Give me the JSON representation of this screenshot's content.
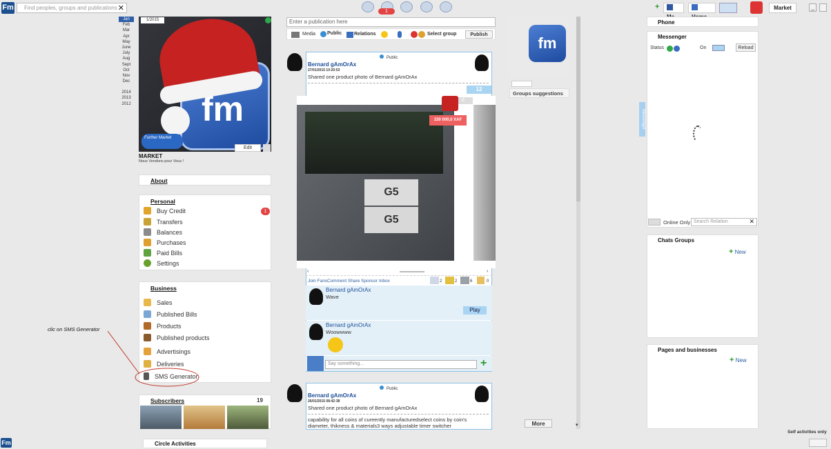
{
  "search": {
    "placeholder": "Find peoples, groups and publications",
    "clear": "✕"
  },
  "topbar": {
    "notif_count": "1",
    "me": "Me",
    "home": "Home",
    "market": "Market",
    "logo": "Fm"
  },
  "sidebar_years": {
    "months": [
      "Jan",
      "Feb",
      "Mar",
      "Apr",
      "May",
      "June",
      "July",
      "Aug",
      "Sept",
      "Oct",
      "Nov",
      "Dec"
    ],
    "years": [
      "2014",
      "2013",
      "2012"
    ]
  },
  "profile": {
    "photo_date": "1/2015",
    "name": "MARKET",
    "tagline": "Nous Vendons pour Vous !",
    "edit": "Edit",
    "logo_text": "fm",
    "brand": "Further Market"
  },
  "about": "About",
  "personal": {
    "title": "Personal",
    "items": [
      "Buy Credit",
      "Transfers",
      "Balances",
      "Purchases",
      "Paid Bills",
      "Settings"
    ],
    "buy_credit_badge": "1"
  },
  "business": {
    "title": "Business",
    "items": [
      "Sales",
      "Published Bills",
      "Products",
      "Published products",
      "Advertisings",
      "Deliveries",
      "SMS Generator"
    ]
  },
  "annotation": "clic on SMS Generator",
  "subscribers": {
    "title": "Subscribers",
    "count": "19"
  },
  "circle": "Circle Activities",
  "composer": {
    "placeholder": "Enter a publication here",
    "media": "Media",
    "public": "Public",
    "relations": "Relations",
    "select_group": "Select group",
    "publish": "Publish"
  },
  "post1": {
    "visibility": "Public",
    "author": "Bernard gAmOrAx",
    "date": "27/01/2015 10:20:53",
    "text": "Shared one product photo of  Bernard gAmOrAx",
    "count": "12",
    "count2": "6",
    "price": "150 000,0 XAF",
    "label_g5_1": "G5",
    "label_g5_2": "G5",
    "actions": [
      "Join Fans",
      "Comment",
      "Share",
      "Sponsor",
      "Inbox"
    ],
    "stats": [
      "2",
      "2",
      "6",
      "0"
    ]
  },
  "comment1": {
    "author": "Bernard gAmOrAx",
    "text": "Wave",
    "play": "Play"
  },
  "comment2": {
    "author": "Bernard gAmOrAx",
    "text": "Woowwww"
  },
  "comment_input": {
    "placeholder": "Say something..."
  },
  "post2": {
    "visibility": "Public",
    "author": "Bernard gAmOrAx",
    "date": "26/01/2015 08:42:38",
    "text": "Shared one product photo of  Bernard gAmOrAx",
    "text2": "capability for all coins of cureently manufacturedselect coins by coin's diameter, thikness & materials3 ways adjustable timer switcher"
  },
  "groups": {
    "title": "Groups suggestions",
    "more": "More"
  },
  "messenger_tab": "Messenger",
  "right": {
    "phone": "Phone",
    "messenger": "Messenger",
    "status": "Status",
    "on": "On",
    "reload": "Reload",
    "online_only": "Online Only",
    "search_relation": "Search Relation",
    "chats_groups": "Chats Groups",
    "new1": "New",
    "pages": "Pages and businesses",
    "new2": "New"
  },
  "footer": {
    "self_activities": "Self activities only"
  }
}
